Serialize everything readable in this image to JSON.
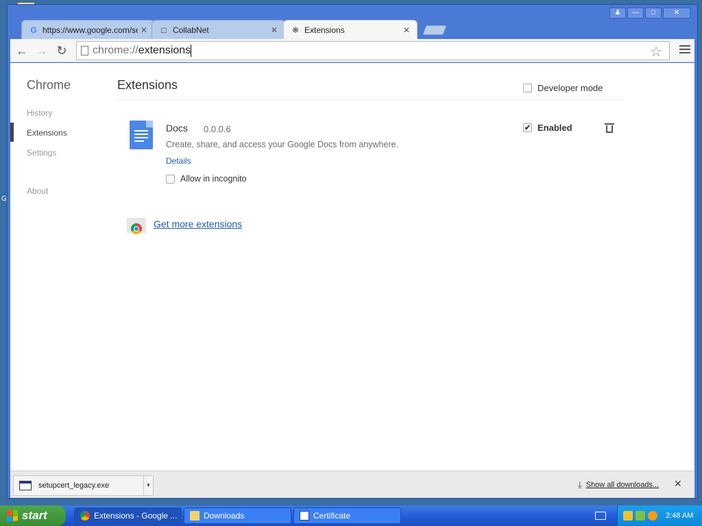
{
  "window": {
    "controls": [
      "user",
      "minimize",
      "maximize",
      "close"
    ]
  },
  "tabs": [
    {
      "title": "https://www.google.com/se",
      "icon": "google-icon"
    },
    {
      "title": "CollabNet",
      "icon": "page-icon"
    },
    {
      "title": "Extensions",
      "icon": "puzzle-icon",
      "active": true
    }
  ],
  "toolbar": {
    "url_scheme": "chrome://",
    "url_path": "extensions"
  },
  "sidebar": {
    "title": "Chrome",
    "items": [
      {
        "label": "History"
      },
      {
        "label": "Extensions",
        "active": true
      },
      {
        "label": "Settings"
      },
      {
        "label": "About"
      }
    ]
  },
  "main": {
    "title": "Extensions",
    "developer_mode": {
      "label": "Developer mode",
      "checked": false
    },
    "extensions": [
      {
        "name": "Docs",
        "version": "0.0.0.6",
        "description": "Create, share, and access your Google Docs from anywhere.",
        "details_label": "Details",
        "incognito_label": "Allow in incognito",
        "incognito_checked": false,
        "enabled_label": "Enabled",
        "enabled_checked": true
      }
    ],
    "get_more_label": "Get more extensions"
  },
  "downloads": {
    "item_name": "setupcert_legacy.exe",
    "show_all_label": "Show all downloads..."
  },
  "taskbar": {
    "start_label": "start",
    "buttons": [
      {
        "label": "Extensions - Google ...",
        "active": true
      },
      {
        "label": "Downloads"
      },
      {
        "label": "Certificate"
      }
    ],
    "clock": "2:48 AM"
  },
  "colors": {
    "desktop": "#3a6ea5",
    "link": "#1f5aa8",
    "taskbar": "#245edb",
    "start": "#3a8c35"
  }
}
